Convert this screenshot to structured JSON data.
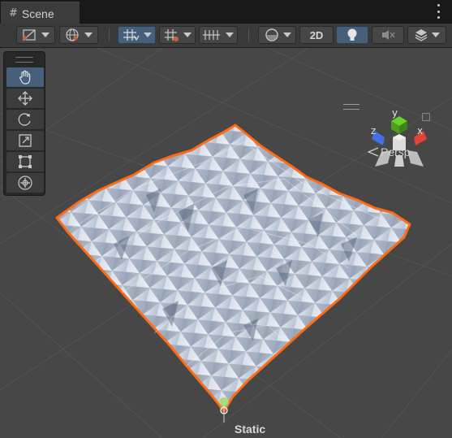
{
  "window": {
    "tab_label": "Scene",
    "tab_icon": "grid-hash-icon",
    "menu_icon": "kebab-menu-icon"
  },
  "toolbar": {
    "draw_mode_icon": "shading-mode-icon",
    "global_icon": "globe-icon",
    "grid_snap_icon": "grid-snap-icon",
    "increment_snap_icon": "increment-snap-icon",
    "grid_visibility_icon": "grid-visibility-icon",
    "orbit_icon": "orbit-icon",
    "mode_2d_label": "2D",
    "lighting_icon": "light-bulb-icon",
    "audio_icon": "audio-mute-icon",
    "effects_icon": "scene-effects-icon"
  },
  "tools": {
    "items": [
      "hand-tool-icon",
      "move-tool-icon",
      "rotate-tool-icon",
      "scale-tool-icon",
      "rect-tool-icon",
      "transform-tool-icon"
    ],
    "active": "hand-tool-icon"
  },
  "gizmo": {
    "axis_x": "x",
    "axis_y": "y",
    "axis_z": "z",
    "projection_label": "Persp"
  },
  "scene": {
    "object_label": "Static",
    "selection_color": "#ff6a14",
    "terrain_color": "#c6cfdc"
  }
}
